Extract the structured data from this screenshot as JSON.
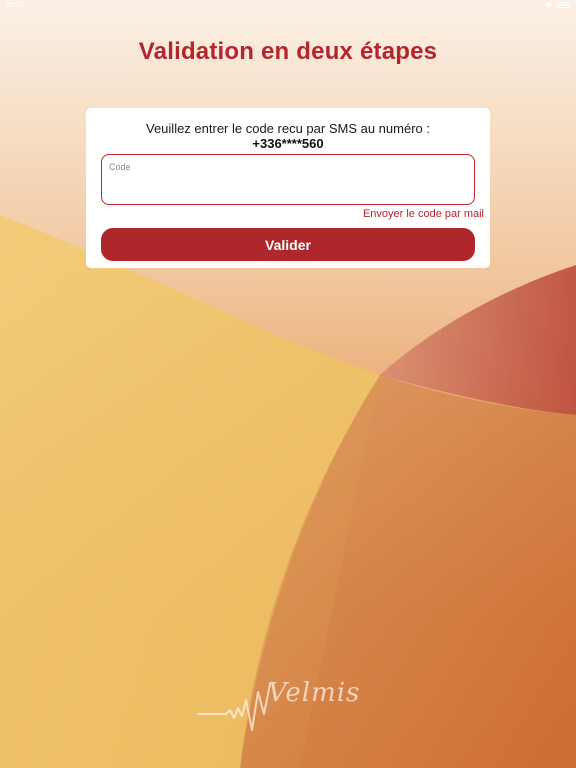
{
  "status_bar": {
    "time": "10:04"
  },
  "header": {
    "title": "Validation en deux étapes"
  },
  "card": {
    "instruction": "Veuillez entrer le code recu par SMS au numéro :",
    "phone_number": "+336****560",
    "code_field": {
      "label": "Code",
      "value": ""
    },
    "email_link": "Envoyer le code par mail",
    "submit_label": "Valider"
  },
  "logo": {
    "text": "Velmis"
  },
  "colors": {
    "accent": "#b3262d",
    "button": "#ae272b",
    "card_background": "#ffffff"
  },
  "icons": [
    "wifi-icon",
    "battery-icon",
    "velmis-logo"
  ]
}
